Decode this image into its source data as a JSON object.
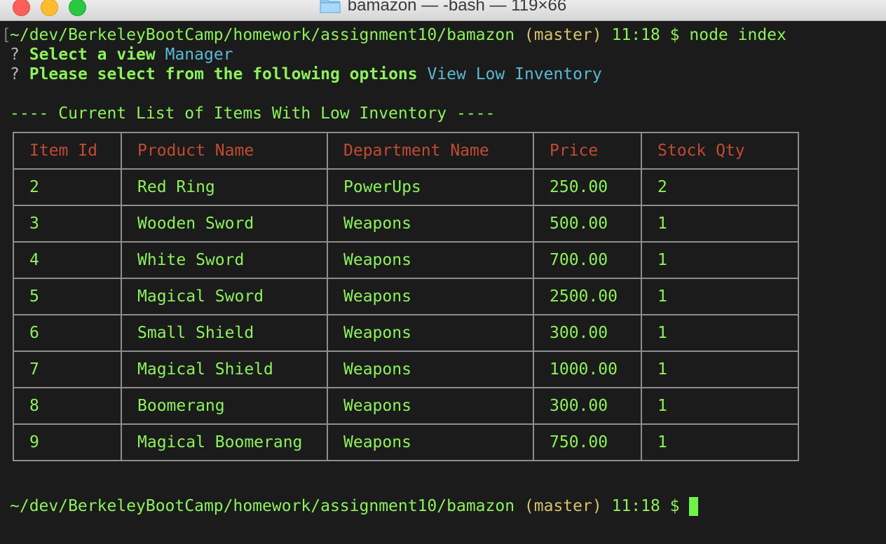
{
  "window": {
    "title": "bamazon — -bash — 119×66"
  },
  "session": {
    "path": "~/dev/BerkeleyBootCamp/homework/assignment10/bamazon",
    "branch": "(master)",
    "time": "11:18",
    "prompt_symbol": "$",
    "command": "node index"
  },
  "prompts": [
    {
      "mark": "?",
      "question": "Select a view",
      "answer": "Manager"
    },
    {
      "mark": "?",
      "question": "Please select from the following options",
      "answer": "View Low Inventory"
    }
  ],
  "report_heading": "---- Current List of Items With Low Inventory ----",
  "table": {
    "headers": [
      "Item Id",
      "Product Name",
      "Department Name",
      "Price",
      "Stock Qty"
    ],
    "rows": [
      [
        "2",
        "Red Ring",
        "PowerUps",
        "250.00",
        "2"
      ],
      [
        "3",
        "Wooden Sword",
        "Weapons",
        "500.00",
        "1"
      ],
      [
        "4",
        "White Sword",
        "Weapons",
        "700.00",
        "1"
      ],
      [
        "5",
        "Magical Sword",
        "Weapons",
        "2500.00",
        "1"
      ],
      [
        "6",
        "Small Shield",
        "Weapons",
        "300.00",
        "1"
      ],
      [
        "7",
        "Magical Shield",
        "Weapons",
        "1000.00",
        "1"
      ],
      [
        "8",
        "Boomerang",
        "Weapons",
        "300.00",
        "1"
      ],
      [
        "9",
        "Magical Boomerang",
        "Weapons",
        "750.00",
        "1"
      ]
    ]
  },
  "colors": {
    "terminal_bg": "#1b1b1b",
    "text_green": "#8cf25c",
    "branch_yellow": "#d7c26a",
    "answer_cyan": "#5bb8d6",
    "header_red": "#c24a32",
    "border_gray": "#8d8d8d"
  }
}
